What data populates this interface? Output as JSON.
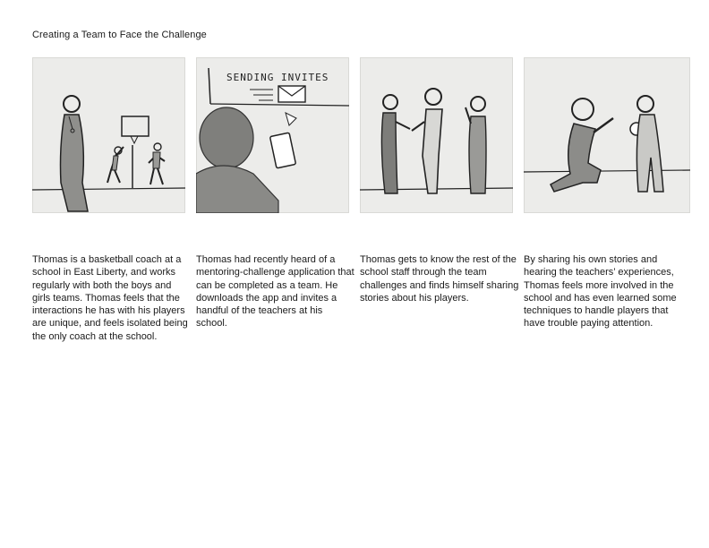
{
  "document": {
    "title": "Creating a Team to Face the Challenge"
  },
  "panels": [
    {
      "illustration_icon": "coach-with-basketball-hoop-sketch",
      "caption": "Thomas is a basketball coach at a school in East Liberty, and works regularly with both the boys and girls teams. Thomas feels that the interactions he has with his players are unique, and feels isolated being the only coach at the school."
    },
    {
      "illustration_icon": "sending-invites-phone-sketch",
      "sketch_text": "SENDING INVITES",
      "caption": "Thomas had recently heard of a mentoring-challenge application that can be completed as a team. He downloads the app and invites a handful of the teachers at his school."
    },
    {
      "illustration_icon": "staff-handshake-sketch",
      "caption": "Thomas gets to know the rest of the school staff through the team challenges and finds himself sharing stories about his players."
    },
    {
      "illustration_icon": "coach-kneeling-with-player-sketch",
      "caption": "By sharing his own stories and hearing the teachers’ experiences, Thomas feels more involved in the school and has even learned some techniques to handle players that have trouble paying attention."
    }
  ]
}
